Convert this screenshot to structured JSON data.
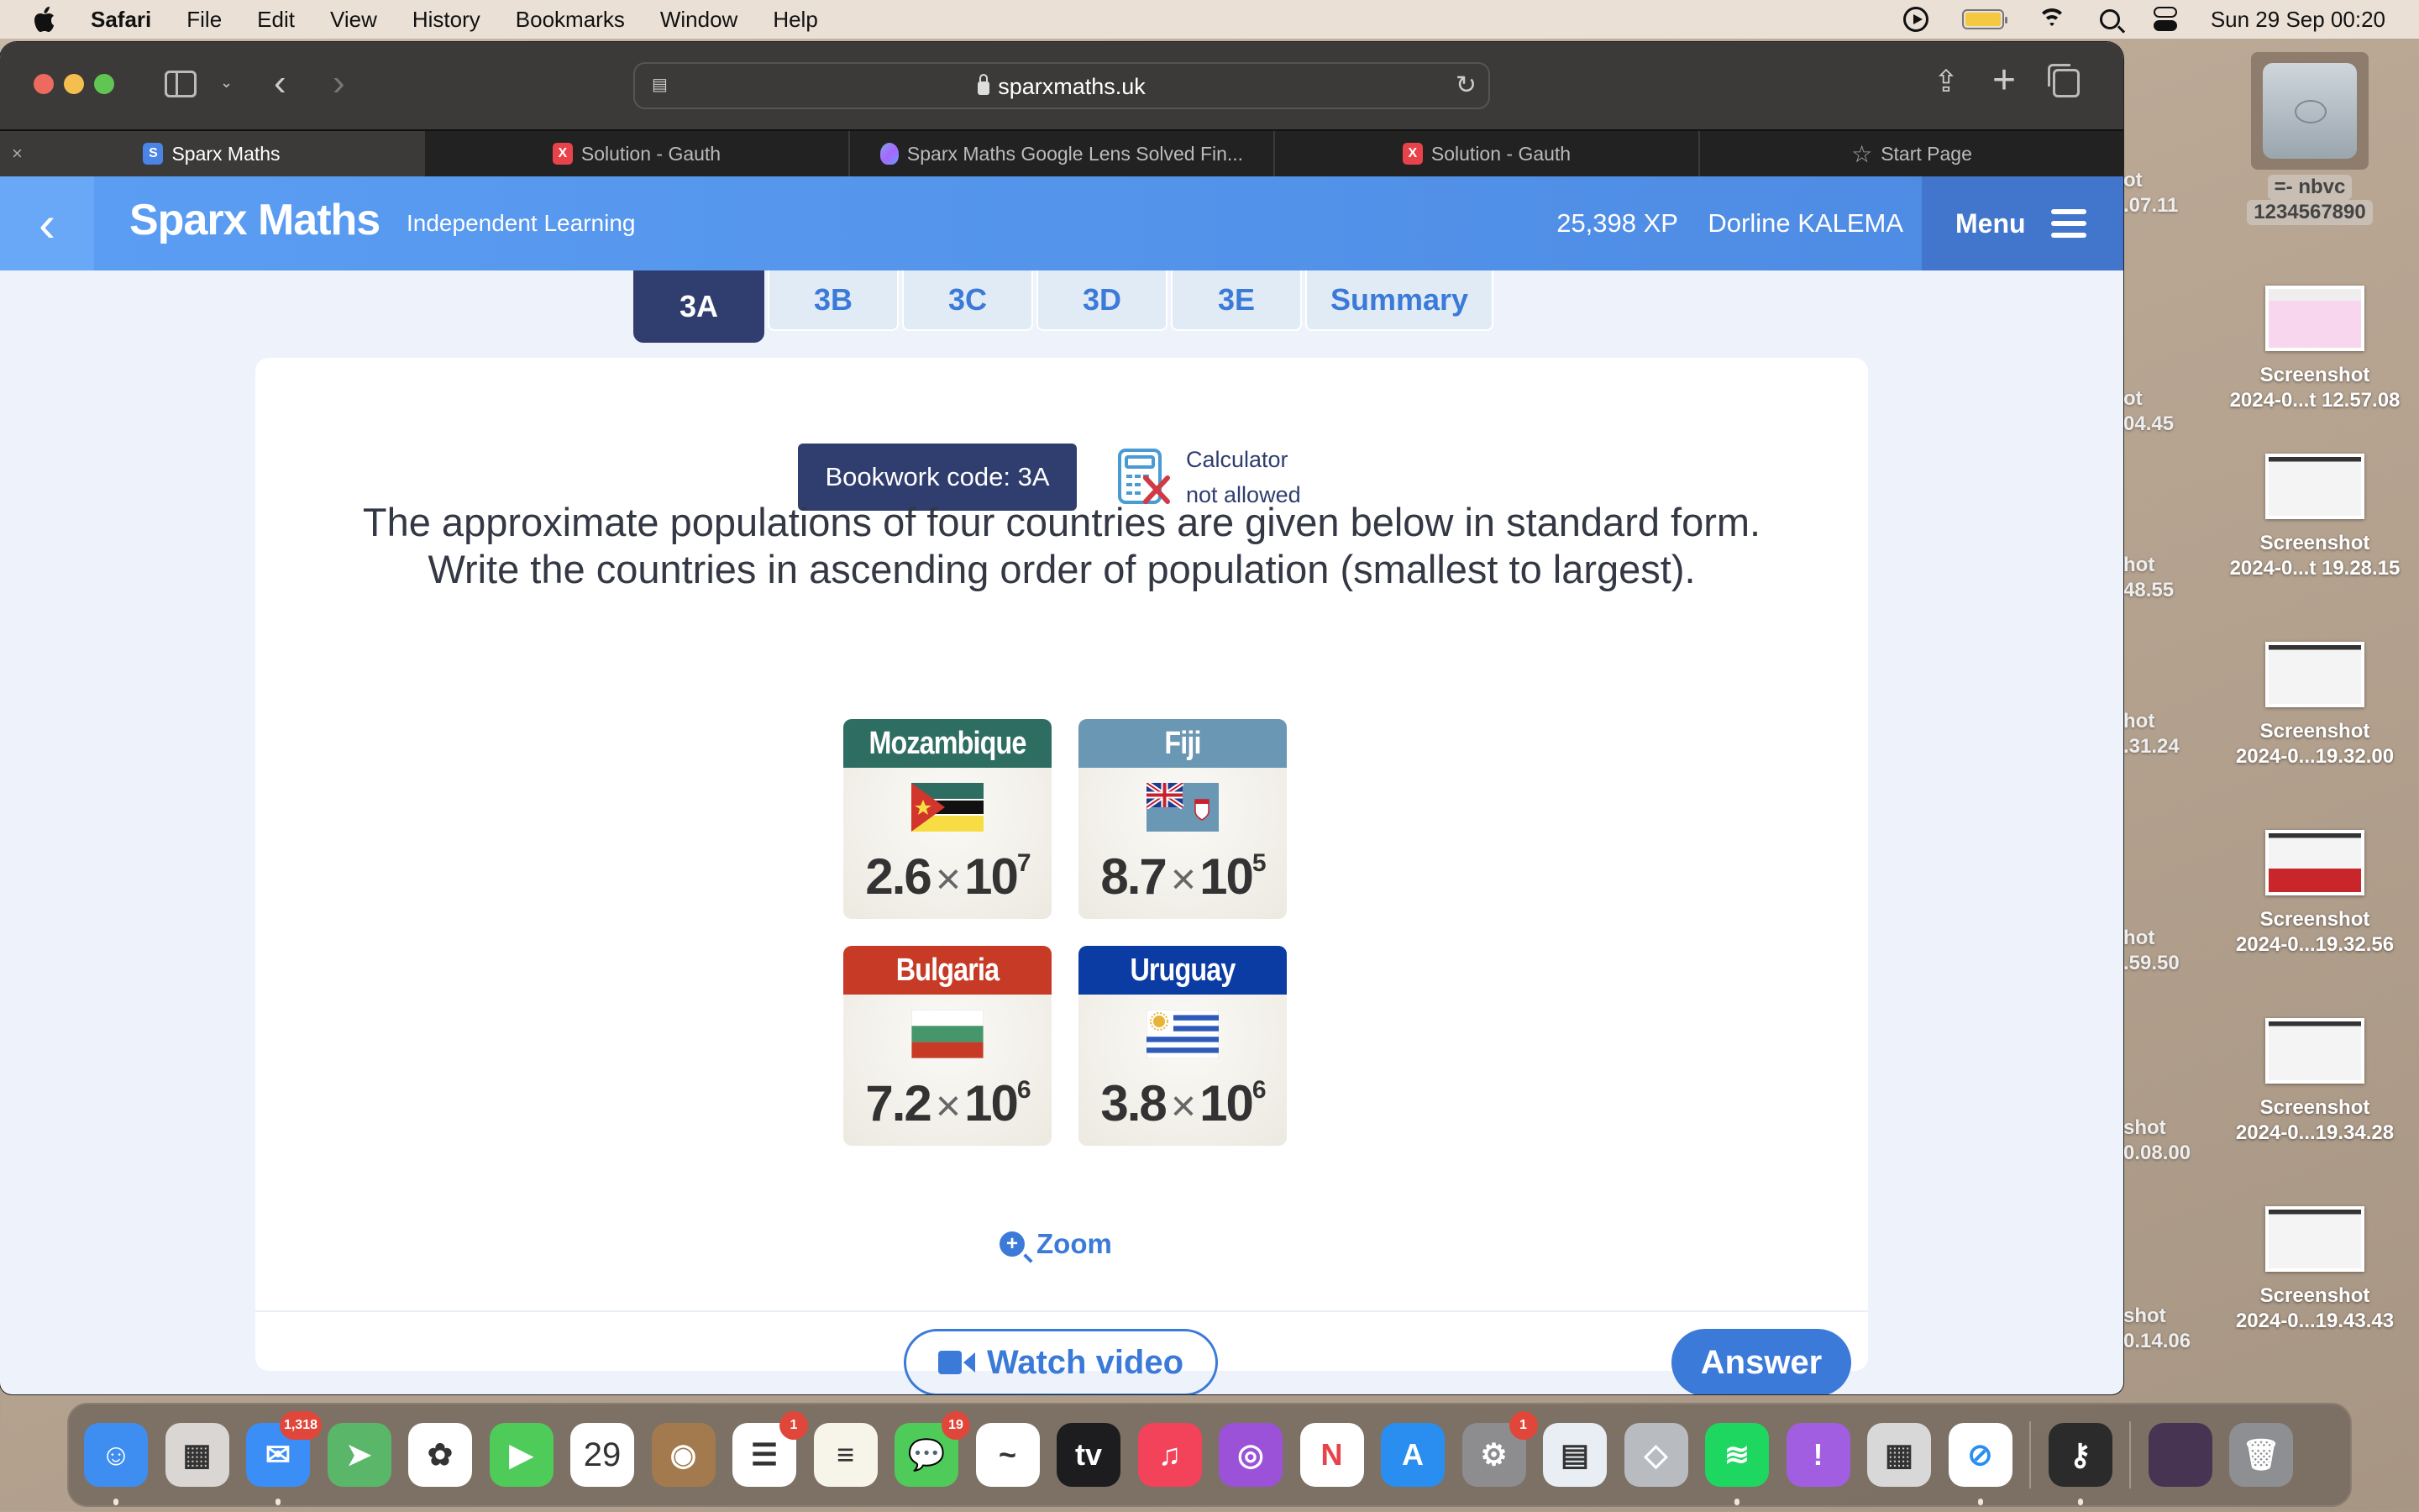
{
  "menubar": {
    "app_name": "Safari",
    "items": [
      "File",
      "Edit",
      "View",
      "History",
      "Bookmarks",
      "Window",
      "Help"
    ],
    "clock": "Sun 29 Sep  00:20",
    "status_icons": [
      "play-icon",
      "battery-icon",
      "wifi-icon",
      "search-icon",
      "control-center-icon"
    ]
  },
  "browser": {
    "url": "sparxmaths.uk",
    "tabs": [
      {
        "label": "Sparx Maths",
        "favicon": "S",
        "active": true
      },
      {
        "label": "Solution - Gauth",
        "favicon": "X",
        "active": false
      },
      {
        "label": "Sparx Maths Google Lens Solved Fin...",
        "favicon": "lens",
        "active": false
      },
      {
        "label": "Solution - Gauth",
        "favicon": "X",
        "active": false
      },
      {
        "label": "Start Page",
        "favicon": "star",
        "active": false
      }
    ],
    "tab_close_glyph": "×"
  },
  "app": {
    "brand": "Sparx Maths",
    "subtitle": "Independent Learning",
    "xp": "25,398 XP",
    "user": "Dorline KALEMA",
    "menu_label": "Menu",
    "question_tabs": [
      {
        "label": "3A",
        "active": true
      },
      {
        "label": "3B",
        "active": false
      },
      {
        "label": "3C",
        "active": false
      },
      {
        "label": "3D",
        "active": false
      },
      {
        "label": "3E",
        "active": false
      },
      {
        "label": "Summary",
        "active": false
      }
    ]
  },
  "question": {
    "bookwork_code": "Bookwork code: 3A",
    "calculator_line1": "Calculator",
    "calculator_line2": "not allowed",
    "line1": "The approximate populations of four countries are given below in standard form.",
    "line2": "Write the countries in ascending order of population (smallest to largest).",
    "countries": [
      {
        "name": "Mozambique",
        "mantissa": "2.6",
        "exponent": "7",
        "header_color": "#2e6e62"
      },
      {
        "name": "Fiji",
        "mantissa": "8.7",
        "exponent": "5",
        "header_color": "#6a97b3"
      },
      {
        "name": "Bulgaria",
        "mantissa": "7.2",
        "exponent": "6",
        "header_color": "#c63a26"
      },
      {
        "name": "Uruguay",
        "mantissa": "3.8",
        "exponent": "6",
        "header_color": "#0b3ca4"
      }
    ],
    "times_glyph": "×",
    "ten": "10",
    "zoom_label": "Zoom",
    "watch_video_label": "Watch video",
    "answer_label": "Answer"
  },
  "desktop": {
    "drive": {
      "line1": "=- nbvc",
      "line2": "1234567890"
    },
    "files": [
      {
        "line1": "Screenshot",
        "line2": "2024-0...t 12.57.08"
      },
      {
        "line1": "Screenshot",
        "line2": "2024-0...t 19.28.15"
      },
      {
        "line1": "Screenshot",
        "line2": "2024-0...19.32.00"
      },
      {
        "line1": "Screenshot",
        "line2": "2024-0...19.32.56"
      },
      {
        "line1": "Screenshot",
        "line2": "2024-0...19.34.28"
      },
      {
        "line1": "Screenshot",
        "line2": "2024-0...19.43.43"
      }
    ],
    "partial_files": [
      {
        "line1": "ot",
        "line2": ".07.11"
      },
      {
        "line1": "ot",
        "line2": "04.45"
      },
      {
        "line1": "hot",
        "line2": "48.55"
      },
      {
        "line1": "hot",
        "line2": ".31.24"
      },
      {
        "line1": "hot",
        "line2": ".59.50"
      },
      {
        "line1": "shot",
        "line2": "0.08.00"
      },
      {
        "line1": "shot",
        "line2": "0.14.06"
      }
    ]
  },
  "dock": {
    "apps": [
      {
        "name": "finder",
        "color": "#3d8ef0",
        "glyph": "☺",
        "running": true
      },
      {
        "name": "launchpad",
        "color": "#d9d6d3",
        "glyph": "▦",
        "running": false
      },
      {
        "name": "mail",
        "color": "#3a8ef5",
        "glyph": "✉",
        "badge": "1,318",
        "running": true
      },
      {
        "name": "maps",
        "color": "#5ab76a",
        "glyph": "➤",
        "running": false
      },
      {
        "name": "photos",
        "color": "#ffffff",
        "glyph": "✿",
        "running": false
      },
      {
        "name": "facetime",
        "color": "#4fcb5a",
        "glyph": "▶",
        "running": false
      },
      {
        "name": "calendar",
        "color": "#ffffff",
        "glyph": "29",
        "running": false
      },
      {
        "name": "contacts",
        "color": "#a37a4e",
        "glyph": "◉",
        "running": false
      },
      {
        "name": "reminders",
        "color": "#ffffff",
        "glyph": "☰",
        "badge": "1",
        "running": false
      },
      {
        "name": "notes",
        "color": "#f7f4e9",
        "glyph": "≡",
        "running": false
      },
      {
        "name": "messages",
        "color": "#4fcb5a",
        "glyph": "💬",
        "badge": "19",
        "running": false
      },
      {
        "name": "freeform",
        "color": "#ffffff",
        "glyph": "~",
        "running": false
      },
      {
        "name": "apple-tv",
        "color": "#1d1d1f",
        "glyph": "tv",
        "running": false
      },
      {
        "name": "music",
        "color": "#f3435a",
        "glyph": "♫",
        "running": false
      },
      {
        "name": "podcasts",
        "color": "#9b52d8",
        "glyph": "◎",
        "running": false
      },
      {
        "name": "news",
        "color": "#ffffff",
        "glyph": "N",
        "running": false
      },
      {
        "name": "app-store",
        "color": "#2a8ef0",
        "glyph": "A",
        "running": false
      },
      {
        "name": "system-settings",
        "color": "#8d8d8f",
        "glyph": "⚙",
        "badge": "1",
        "running": false
      },
      {
        "name": "preview",
        "color": "#e9eef4",
        "glyph": "▤",
        "running": false
      },
      {
        "name": "roblox",
        "color": "#b8bcc0",
        "glyph": "◇",
        "running": false
      },
      {
        "name": "spotify",
        "color": "#1ed760",
        "glyph": "≋",
        "running": true
      },
      {
        "name": "feedback-assistant",
        "color": "#a25ee0",
        "glyph": "!",
        "running": false
      },
      {
        "name": "calculator",
        "color": "#d8d8d8",
        "glyph": "▦",
        "running": false
      },
      {
        "name": "safari",
        "color": "#ffffff",
        "glyph": "⊘",
        "running": true
      },
      {
        "name": "keychain-access",
        "color": "#2b2b2b",
        "glyph": "⚷",
        "running": true
      },
      {
        "name": "downloads-stack",
        "color": "#473453",
        "glyph": "",
        "running": false
      },
      {
        "name": "trash",
        "color": "#8d8f92",
        "glyph": "🗑",
        "running": false
      }
    ]
  }
}
